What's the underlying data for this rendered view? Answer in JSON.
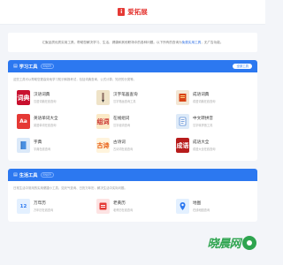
{
  "header": {
    "brand_mark": "i",
    "brand_name": "爱拓展"
  },
  "intro": {
    "text": "汇聚品质优质实用工具，帮助您解决学习、生活、健康和其他职场中的各种问题。以下所有的查询为",
    "highlight": "免费实用工具",
    "suffix": "，无广告功能。"
  },
  "sections": [
    {
      "title": "学习工具",
      "badge": "ENJOY",
      "more": "全部工具",
      "desc": "这些工具可以帮助您更高效地学习知识和报考试，包括词典查询、公式计算、知识的分类等。",
      "tools": [
        {
          "name": "汉语词典",
          "desc": "汉语词典在线查询",
          "icon": "dictionary-icon",
          "icon_text": "词典",
          "icon_bg": "#c8102e"
        },
        {
          "name": "汉字笔画查询",
          "desc": "汉字笔画查询工具",
          "icon": "brush-stroke-icon",
          "icon_text": "",
          "icon_bg": "#efe3c8"
        },
        {
          "name": "成语词典",
          "desc": "成语词典在线查询",
          "icon": "idiom-book-icon",
          "icon_text": "",
          "icon_bg": "#f3e7d5"
        },
        {
          "name": "英语单词大全",
          "desc": "英语单词在线查询",
          "icon": "english-icon",
          "icon_text": "Aa",
          "icon_bg": "#e53935"
        },
        {
          "name": "在线组词",
          "desc": "汉字组词查询",
          "icon": "word-group-icon",
          "icon_text": "组词",
          "icon_bg": "#fbe9c6"
        },
        {
          "name": "中文转拼音",
          "desc": "汉字转拼音工具",
          "icon": "pinyin-icon",
          "icon_text": "",
          "icon_bg": "#ddeaf8"
        },
        {
          "name": "字典",
          "desc": "字典在线查询",
          "icon": "book-icon",
          "icon_text": "",
          "icon_bg": "#dbe9f9"
        },
        {
          "name": "古诗词",
          "desc": "古诗词在线查询",
          "icon": "poetry-icon",
          "icon_text": "古诗",
          "icon_bg": "#fff4dd"
        },
        {
          "name": "成语大全",
          "desc": "成语大全在线查询",
          "icon": "idiom-seal-icon",
          "icon_text": "成语",
          "icon_bg": "#b71c1c"
        }
      ]
    },
    {
      "title": "生活工具",
      "badge": "ENJOY",
      "more": "",
      "desc": "日常生活中常用的实用便捷小工具，如天气查询、日历万年历，解决生活中实际问题。",
      "tools": [
        {
          "name": "万年历",
          "desc": "万年历在线查询",
          "icon": "calendar-icon",
          "icon_text": "12",
          "icon_bg": "#e3f0ff"
        },
        {
          "name": "老黄历",
          "desc": "老黄历在线查询",
          "icon": "almanac-icon",
          "icon_text": "",
          "icon_bg": "#fde3e3"
        },
        {
          "name": "地图",
          "desc": "在线地图查询",
          "icon": "map-icon",
          "icon_text": "",
          "icon_bg": "#e3f0ff"
        }
      ]
    }
  ],
  "watermark": {
    "text": "晓晨网"
  }
}
